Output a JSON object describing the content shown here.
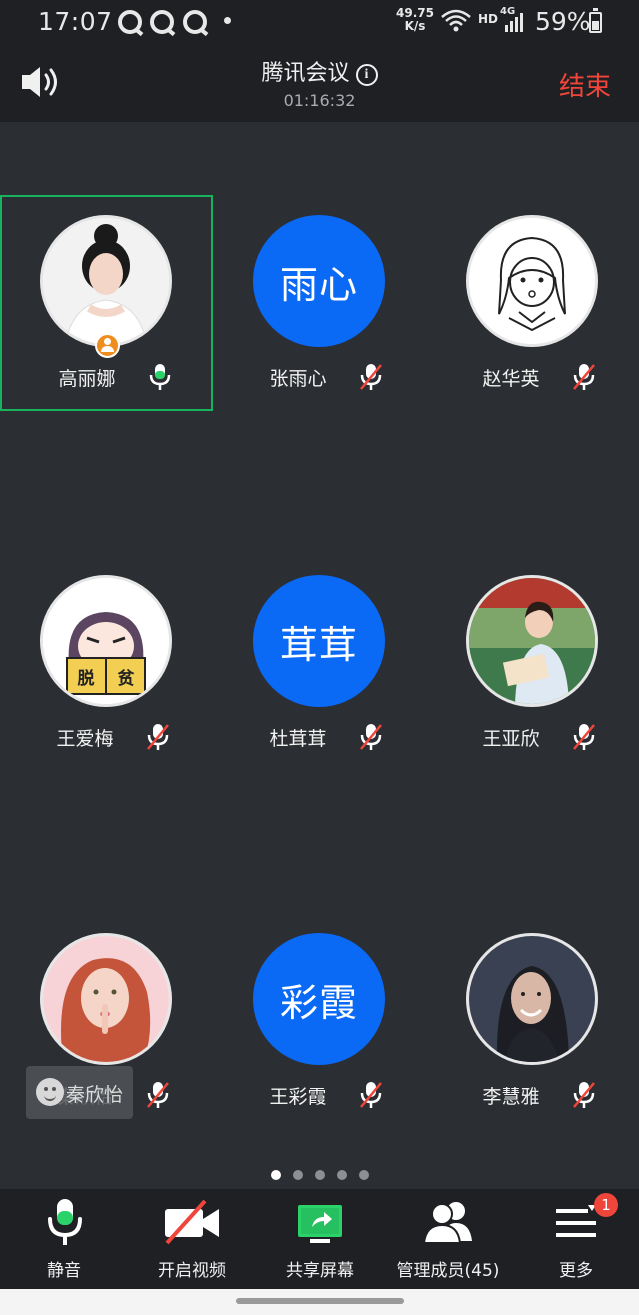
{
  "status_bar": {
    "time": "17:07",
    "net_speed_value": "49.75",
    "net_speed_unit": "K/s",
    "hd_label": "HD",
    "network_label": "4G",
    "battery": "59%"
  },
  "header": {
    "title": "腾讯会议",
    "timer": "01:16:32",
    "end_label": "结束"
  },
  "participants": [
    {
      "name": "高丽娜",
      "avatar_type": "photo",
      "mic": "on",
      "is_host": true,
      "active_speaker": true
    },
    {
      "name": "张雨心",
      "avatar_type": "text",
      "avatar_text": "雨心",
      "mic": "muted"
    },
    {
      "name": "赵华英",
      "avatar_type": "photo",
      "mic": "muted"
    },
    {
      "name": "王爱梅",
      "avatar_type": "photo",
      "avatar_caption": "脱贫",
      "mic": "muted"
    },
    {
      "name": "杜茸茸",
      "avatar_type": "text",
      "avatar_text": "茸茸",
      "mic": "muted"
    },
    {
      "name": "王亚欣",
      "avatar_type": "photo",
      "mic": "muted"
    },
    {
      "name": "秦欣怡",
      "avatar_type": "photo",
      "mic": "muted"
    },
    {
      "name": "王彩霞",
      "avatar_type": "text",
      "avatar_text": "彩霞",
      "mic": "muted"
    },
    {
      "name": "李慧雅",
      "avatar_type": "photo",
      "mic": "muted"
    }
  ],
  "pager": {
    "total": 5,
    "current": 1
  },
  "floating_chip": {
    "text": "秦欣怡"
  },
  "toolbar": {
    "mute_label": "静音",
    "video_label": "开启视频",
    "share_label": "共享屏幕",
    "members_label": "管理成员(45)",
    "more_label": "更多",
    "more_badge": "1"
  },
  "colors": {
    "background": "#2b2e33",
    "bar": "#1f2024",
    "accent_blue": "#0a6af5",
    "active_green": "#18b35c",
    "danger_red": "#f0453a",
    "host_orange": "#f08d1f"
  }
}
